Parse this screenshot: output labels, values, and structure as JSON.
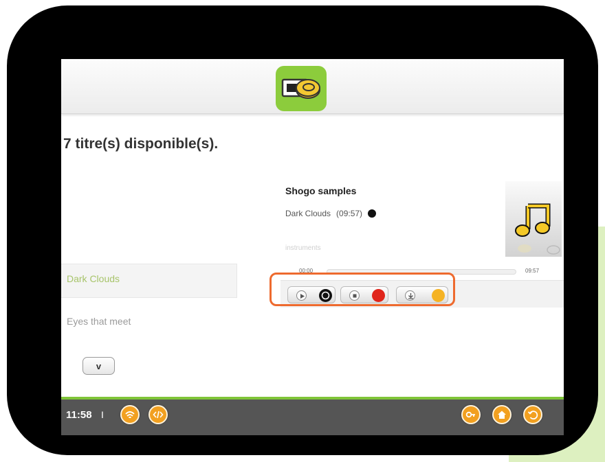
{
  "heading": "7 titre(s) disponible(s).",
  "list": {
    "items": [
      {
        "label": "Dark Clouds",
        "selected": true
      },
      {
        "label": "Eyes that meet",
        "selected": false
      }
    ],
    "scroll_down_glyph": "v"
  },
  "player": {
    "album_title": "Shogo samples",
    "track": "Dark Clouds",
    "duration": "(09:57)",
    "category": "instruments",
    "elapsed": "00:00",
    "total": "09:57",
    "progress": 0,
    "controls": [
      {
        "name": "play",
        "icon": "play-icon",
        "dot_color": "#111111"
      },
      {
        "name": "stop",
        "icon": "stop-icon",
        "dot_color": "#e0251b"
      },
      {
        "name": "download",
        "icon": "download-icon",
        "dot_color": "#f5b324"
      }
    ]
  },
  "statusbar": {
    "time": "11:58",
    "separator": "I",
    "left_icons": [
      "wifi-icon",
      "code-icon"
    ],
    "right_icons": [
      "key-icon",
      "home-icon",
      "back-icon"
    ]
  },
  "colors": {
    "accent_green": "#8ccc3c",
    "accent_orange": "#f2a020",
    "highlight": "#ee6a2e"
  }
}
